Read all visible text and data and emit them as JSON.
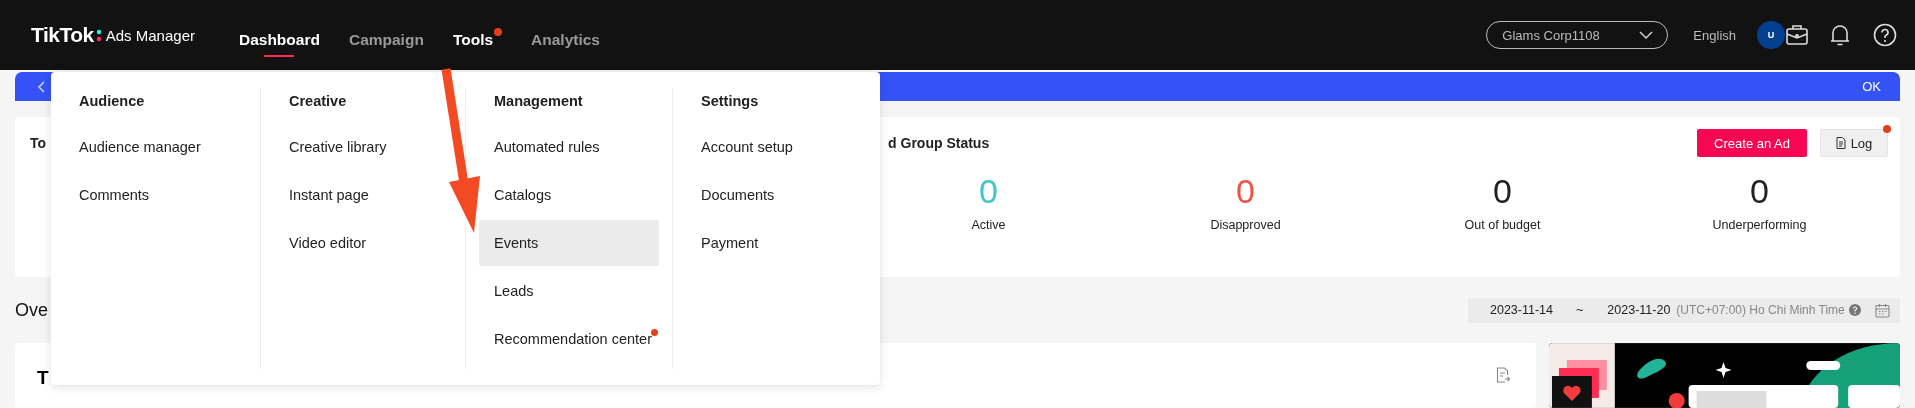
{
  "top_bar": {
    "logo": "TikTok",
    "logo_suffix": "Ads Manager",
    "nav": [
      {
        "label": "Dashboard",
        "selected": true,
        "expanded": false,
        "dot": false
      },
      {
        "label": "Campaign",
        "selected": false,
        "expanded": false,
        "dot": false
      },
      {
        "label": "Tools",
        "selected": false,
        "expanded": true,
        "dot": true
      },
      {
        "label": "Analytics",
        "selected": false,
        "expanded": false,
        "dot": false
      }
    ],
    "account": "Glams Corp1108",
    "language": "English",
    "avatar": "U"
  },
  "banner": {
    "action": "OK"
  },
  "tools_menu": {
    "columns": [
      {
        "heading": "Audience",
        "items": [
          {
            "label": "Audience manager",
            "highlighted": false,
            "dot": false
          },
          {
            "label": "Comments",
            "highlighted": false,
            "dot": false
          }
        ]
      },
      {
        "heading": "Creative",
        "items": [
          {
            "label": "Creative library",
            "highlighted": false,
            "dot": false
          },
          {
            "label": "Instant page",
            "highlighted": false,
            "dot": false
          },
          {
            "label": "Video editor",
            "highlighted": false,
            "dot": false
          }
        ]
      },
      {
        "heading": "Management",
        "items": [
          {
            "label": "Automated rules",
            "highlighted": false,
            "dot": false
          },
          {
            "label": "Catalogs",
            "highlighted": false,
            "dot": false
          },
          {
            "label": "Events",
            "highlighted": true,
            "dot": false
          },
          {
            "label": "Leads",
            "highlighted": false,
            "dot": false
          },
          {
            "label": "Recommendation center",
            "highlighted": false,
            "dot": true
          }
        ]
      },
      {
        "heading": "Settings",
        "items": [
          {
            "label": "Account setup",
            "highlighted": false,
            "dot": false
          },
          {
            "label": "Documents",
            "highlighted": false,
            "dot": false
          },
          {
            "label": "Payment",
            "highlighted": false,
            "dot": false
          }
        ]
      }
    ]
  },
  "status_card": {
    "title": "To",
    "subtitle": "d Group Status",
    "create_button": "Create an Ad",
    "log_button": "Log",
    "log_dot": true,
    "stats": [
      {
        "value": "0",
        "label": "Active",
        "color": "#3cc8c6"
      },
      {
        "value": "0",
        "label": "Disapproved",
        "color": "#f0524b"
      },
      {
        "value": "0",
        "label": "Out of budget",
        "color": "#222222"
      },
      {
        "value": "0",
        "label": "Underperforming",
        "color": "#222222"
      }
    ]
  },
  "overview": {
    "title": "Ove",
    "date_start": "2023-11-14",
    "separator": "~",
    "date_end": "2023-11-20",
    "timezone": "(UTC+07:00) Ho Chi Minh Time"
  },
  "lower_card": {
    "title": "T"
  }
}
